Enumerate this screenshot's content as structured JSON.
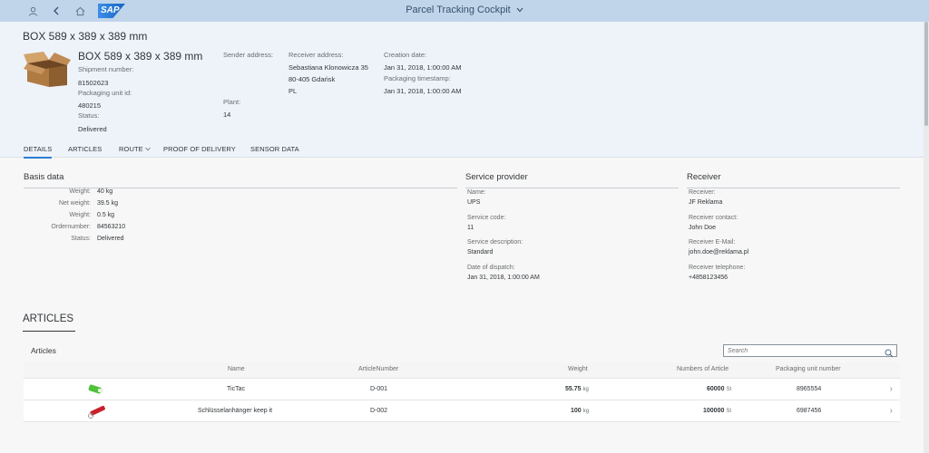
{
  "shell": {
    "logo": "SAP",
    "title": "Parcel Tracking Cockpit"
  },
  "header": {
    "page_title": "BOX 589 x 389 x 389 mm",
    "object_title": "BOX 589 x 389 x 389 mm",
    "shipment_number_label": "Shipment number:",
    "shipment_number": "81502623",
    "packaging_unit_id_label": "Packaging unit id:",
    "packaging_unit_id": "480215",
    "status_label": "Status:",
    "status": "Delivered",
    "sender_address_label": "Sender address:",
    "plant_label": "Plant:",
    "plant": "14",
    "receiver_address_label": "Receiver address:",
    "receiver_address_line1": "Sebastiana Klonowicza 35",
    "receiver_address_line2": "80-405 Gdańsk",
    "receiver_address_line3": "PL",
    "creation_date_label": "Creation date:",
    "creation_date": "Jan 31, 2018, 1:00:00 AM",
    "packaging_timestamp_label": "Packaging timestamp:",
    "packaging_timestamp": "Jan 31, 2018, 1:00:00 AM"
  },
  "tabs": [
    "DETAILS",
    "ARTICLES",
    "ROUTE",
    "PROOF OF DELIVERY",
    "SENSOR DATA"
  ],
  "basis": {
    "title": "Basis data",
    "fields": [
      {
        "label": "Weight:",
        "value": "40 kg"
      },
      {
        "label": "Net weight:",
        "value": "39.5 kg"
      },
      {
        "label": "Weight:",
        "value": "0.5 kg"
      },
      {
        "label": "Ordernumber:",
        "value": "84563210"
      },
      {
        "label": "Status:",
        "value": "Delivered"
      }
    ]
  },
  "service_provider": {
    "title": "Service provider",
    "fields": [
      {
        "label": "Name:",
        "value": "UPS"
      },
      {
        "label": "Service code:",
        "value": "11"
      },
      {
        "label": "Service description:",
        "value": "Standard"
      },
      {
        "label": "Date of dispatch:",
        "value": "Jan 31, 2018, 1:00:00 AM"
      }
    ]
  },
  "receiver": {
    "title": "Receiver",
    "fields": [
      {
        "label": "Receiver:",
        "value": "JF Reklama"
      },
      {
        "label": "Receiver contact:",
        "value": "John Doe"
      },
      {
        "label": "Receiver E-Mail:",
        "value": "john.doe@reklama.pl"
      },
      {
        "label": "Receiver telephone:",
        "value": "+4858123456"
      }
    ]
  },
  "articles": {
    "heading": "ARTICLES",
    "table_title": "Articles",
    "search_placeholder": "Search",
    "columns": [
      "Name",
      "ArticleNumber",
      "Weight",
      "Numbers of Article",
      "Packaging unit number"
    ],
    "rows": [
      {
        "name": "TicTac",
        "article_number": "D-001",
        "weight": "55.75",
        "weight_unit": "kg",
        "count": "60000",
        "count_unit": "St",
        "pu_number": "8965554",
        "image_color": "#4fc13a"
      },
      {
        "name": "Schlüsselanhänger keep it",
        "article_number": "D-002",
        "weight": "100",
        "weight_unit": "kg",
        "count": "100000",
        "count_unit": "St",
        "pu_number": "6987456",
        "image_color": "#c8232c"
      }
    ]
  }
}
